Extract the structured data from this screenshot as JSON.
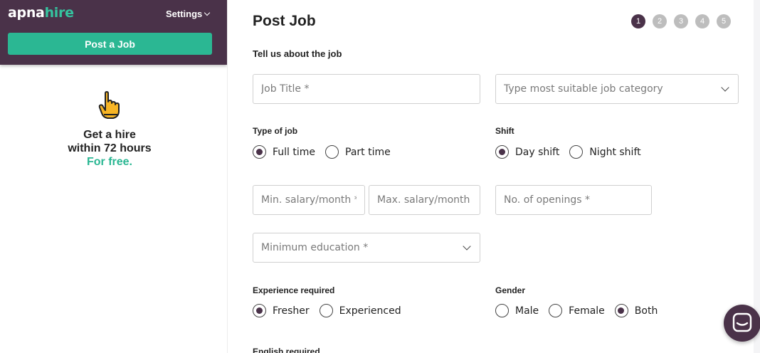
{
  "header": {
    "logo_part1": "apna",
    "logo_part2": "hire",
    "settings_label": "Settings",
    "post_job_button": "Post a Job"
  },
  "promo": {
    "line1": "Get a hire",
    "line2": "within 72 hours",
    "line3": "For free."
  },
  "form": {
    "title": "Post Job",
    "steps": [
      "1",
      "2",
      "3",
      "4",
      "5"
    ],
    "active_step": "1",
    "subtitle": "Tell us about the job",
    "job_title_placeholder": "Job Title *",
    "job_category_placeholder": "Type most suitable job category",
    "type_of_job": {
      "label": "Type of job",
      "options": [
        "Full time",
        "Part time"
      ],
      "selected": "Full time"
    },
    "shift": {
      "label": "Shift",
      "options": [
        "Day shift",
        "Night shift"
      ],
      "selected": "Day shift"
    },
    "min_salary_placeholder": "Min. salary/month *",
    "max_salary_placeholder": "Max. salary/month *",
    "openings_placeholder": "No. of openings *",
    "education_placeholder": "Minimum education *",
    "experience": {
      "label": "Experience required",
      "options": [
        "Fresher",
        "Experienced"
      ],
      "selected": "Fresher"
    },
    "gender": {
      "label": "Gender",
      "options": [
        "Male",
        "Female",
        "Both"
      ],
      "selected": "Both"
    },
    "english_label": "English required"
  },
  "colors": {
    "brand_dark": "#4a3249",
    "brand_green": "#2bb793",
    "step_inactive": "#bdbdbd"
  },
  "icons": [
    "pointing-hand-icon",
    "chevron-down-icon",
    "chat-icon"
  ]
}
